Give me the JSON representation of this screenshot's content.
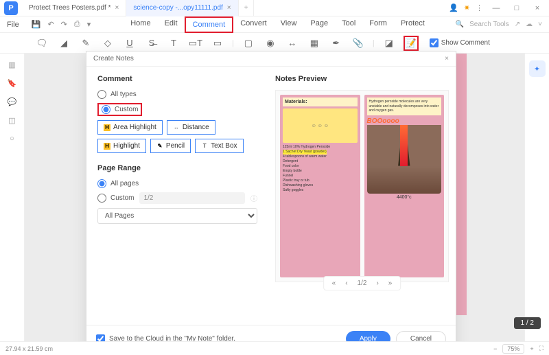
{
  "app": {
    "icon_letter": "P"
  },
  "tabs": [
    {
      "label": "Protect Trees Posters.pdf *",
      "active": false
    },
    {
      "label": "science-copy -...opy11111.pdf",
      "active": true
    }
  ],
  "menubar": {
    "file": "File",
    "items": [
      "Home",
      "Edit",
      "Comment",
      "Convert",
      "View",
      "Page",
      "Tool",
      "Form",
      "Protect"
    ],
    "highlighted_index": 2,
    "search_placeholder": "Search Tools"
  },
  "toolbar": {
    "show_comment_label": "Show Comment",
    "show_comment_checked": true
  },
  "dialog": {
    "title": "Create Notes",
    "comment": {
      "heading": "Comment",
      "all_types": "All types",
      "custom": "Custom",
      "chips": [
        "Area Highlight",
        "Distance",
        "Highlight",
        "Pencil",
        "Text Box"
      ]
    },
    "page_range": {
      "heading": "Page Range",
      "all_pages": "All pages",
      "custom": "Custom",
      "custom_value": "1/2",
      "select_value": "All Pages"
    },
    "preview": {
      "heading": "Notes Preview",
      "card1": {
        "title": "Materials:",
        "items": [
          "125ml 10% Hydrogen Peroxide",
          "1 Sachet Dry Yeast (powder)",
          "4 tablespoons of warm water",
          "Detergent",
          "Food color",
          "Empty bottle",
          "Funnel",
          "Plastic tray or tub",
          "Dishwashing gloves",
          "Safty goggles"
        ]
      },
      "card2": {
        "bubble": "BOOoooo",
        "temp": "4400°c"
      },
      "nav_label": "1/2"
    },
    "footer": {
      "save_cloud": "Save to the Cloud in the \"My Note\" folder.",
      "apply": "Apply",
      "cancel": "Cancel"
    }
  },
  "status": {
    "dimensions": "27.94 x 21.59 cm",
    "zoom": "75%",
    "page_badge": "1 / 2"
  }
}
